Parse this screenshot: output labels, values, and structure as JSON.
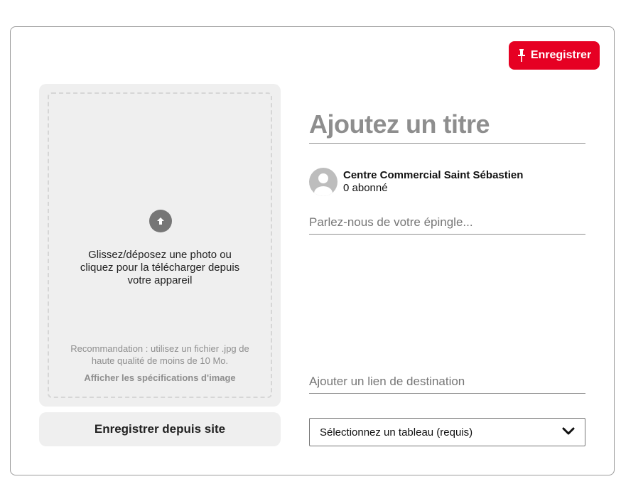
{
  "header": {
    "save_label": "Enregistrer",
    "accent": "#e60023"
  },
  "upload": {
    "instructions": "Glissez/déposez une photo ou cliquez pour la télécharger depuis votre appareil",
    "recommendation": "Recommandation : utilisez un fichier .jpg de haute qualité de moins de 10 Mo.",
    "specs_link": "Afficher les spécifications d'image",
    "icon": "arrow-up-circle-icon"
  },
  "site_button_label": "Enregistrer depuis site",
  "form": {
    "title_placeholder": "Ajoutez un titre",
    "author": {
      "name": "Centre Commercial Saint Sébastien",
      "followers": "0 abonné"
    },
    "description_placeholder": "Parlez-nous de votre épingle...",
    "link_placeholder": "Ajouter un lien de destination",
    "board_select": "Sélectionnez un tableau (requis)"
  }
}
